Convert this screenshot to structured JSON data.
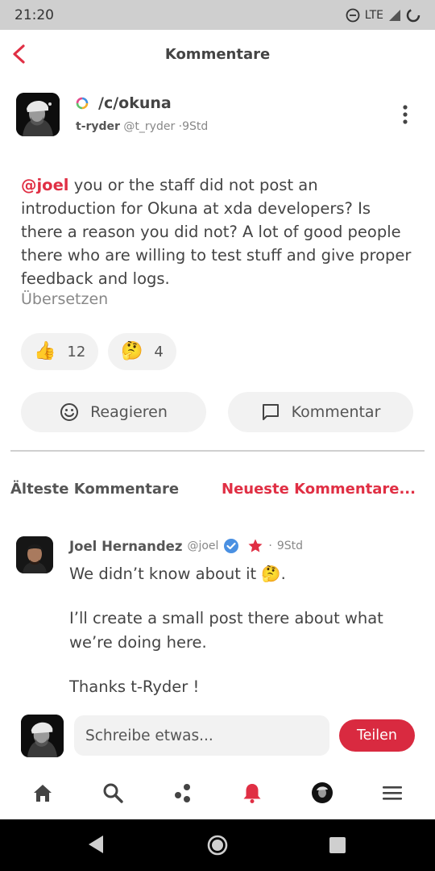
{
  "status_bar": {
    "time": "21:20",
    "network": "LTE"
  },
  "app_bar": {
    "title": "Kommentare",
    "back_icon": "chevron-left-icon"
  },
  "post": {
    "community": "/c/okuna",
    "username": "t-ryder",
    "handle": "@t_ryder",
    "time": "9Std",
    "mention": "@joel",
    "body": "you or the staff did not post an introduction for Okuna at xda developers? Is there a reason you did not? A lot of good people there who are willing to test stuff and give proper feedback and logs.",
    "translate_label": "Übersetzen",
    "reactions": [
      {
        "emoji": "👍",
        "count": "12"
      },
      {
        "emoji": "🤔",
        "count": "4"
      }
    ],
    "react_label": "Reagieren",
    "comment_label": "Kommentar"
  },
  "sort": {
    "oldest": "Älteste Kommentare",
    "newest": "Neueste Kommentare..."
  },
  "comment": {
    "name": "Joel Hernandez",
    "handle": "@joel",
    "time": "9Std",
    "lines": [
      "We didn’t know about it 🤔.",
      "I’ll create a small post there about what we’re doing here.",
      "Thanks t-Ryder !"
    ]
  },
  "composer": {
    "placeholder": "Schreibe etwas...",
    "send_label": "Teilen"
  },
  "bottom_nav": [
    "home-icon",
    "search-icon",
    "communities-icon",
    "notifications-icon",
    "profile-avatar",
    "menu-icon"
  ],
  "colors": {
    "accent": "#e02f44",
    "pill_bg": "#f2f2f2",
    "status_bar": "#cfcfcf"
  }
}
